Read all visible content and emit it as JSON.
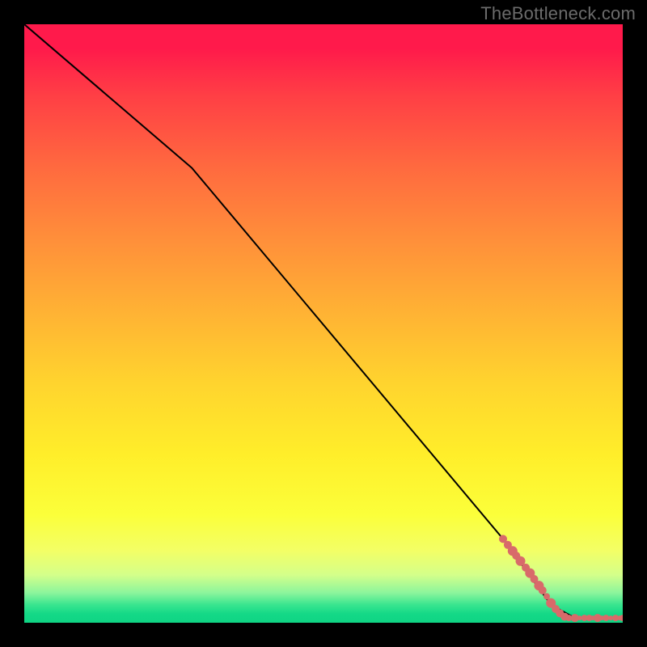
{
  "watermark": "TheBottleneck.com",
  "chart_data": {
    "type": "line",
    "title": "",
    "xlabel": "",
    "ylabel": "",
    "xlim": [
      0,
      100
    ],
    "ylim": [
      0,
      100
    ],
    "curve": [
      {
        "x": 0,
        "y": 100
      },
      {
        "x": 28,
        "y": 76
      },
      {
        "x": 80,
        "y": 14
      },
      {
        "x": 88,
        "y": 3
      },
      {
        "x": 92,
        "y": 0.8
      },
      {
        "x": 100,
        "y": 0.8
      }
    ],
    "markers": [
      {
        "x": 80.0,
        "y": 14.0,
        "r": 5
      },
      {
        "x": 80.8,
        "y": 13.0,
        "r": 5
      },
      {
        "x": 81.6,
        "y": 12.0,
        "r": 6
      },
      {
        "x": 82.2,
        "y": 11.2,
        "r": 5
      },
      {
        "x": 82.9,
        "y": 10.3,
        "r": 6
      },
      {
        "x": 83.8,
        "y": 9.2,
        "r": 5
      },
      {
        "x": 84.5,
        "y": 8.3,
        "r": 6
      },
      {
        "x": 85.2,
        "y": 7.3,
        "r": 5
      },
      {
        "x": 86.0,
        "y": 6.2,
        "r": 6
      },
      {
        "x": 86.6,
        "y": 5.4,
        "r": 5
      },
      {
        "x": 87.3,
        "y": 4.4,
        "r": 4
      },
      {
        "x": 88.0,
        "y": 3.3,
        "r": 6
      },
      {
        "x": 88.8,
        "y": 2.3,
        "r": 5
      },
      {
        "x": 89.5,
        "y": 1.6,
        "r": 5
      },
      {
        "x": 90.3,
        "y": 1.0,
        "r": 5
      },
      {
        "x": 91.0,
        "y": 0.8,
        "r": 4
      },
      {
        "x": 92.0,
        "y": 0.8,
        "r": 5
      },
      {
        "x": 92.8,
        "y": 0.8,
        "r": 3
      },
      {
        "x": 93.6,
        "y": 0.8,
        "r": 4
      },
      {
        "x": 94.4,
        "y": 0.8,
        "r": 4
      },
      {
        "x": 95.0,
        "y": 0.8,
        "r": 3
      },
      {
        "x": 95.8,
        "y": 0.8,
        "r": 5
      },
      {
        "x": 96.5,
        "y": 0.8,
        "r": 3
      },
      {
        "x": 97.2,
        "y": 0.8,
        "r": 4
      },
      {
        "x": 98.0,
        "y": 0.8,
        "r": 3
      },
      {
        "x": 98.8,
        "y": 0.8,
        "r": 4
      },
      {
        "x": 99.5,
        "y": 0.8,
        "r": 3
      },
      {
        "x": 100.0,
        "y": 0.8,
        "r": 4
      }
    ],
    "marker_color": "#d86a6a"
  }
}
